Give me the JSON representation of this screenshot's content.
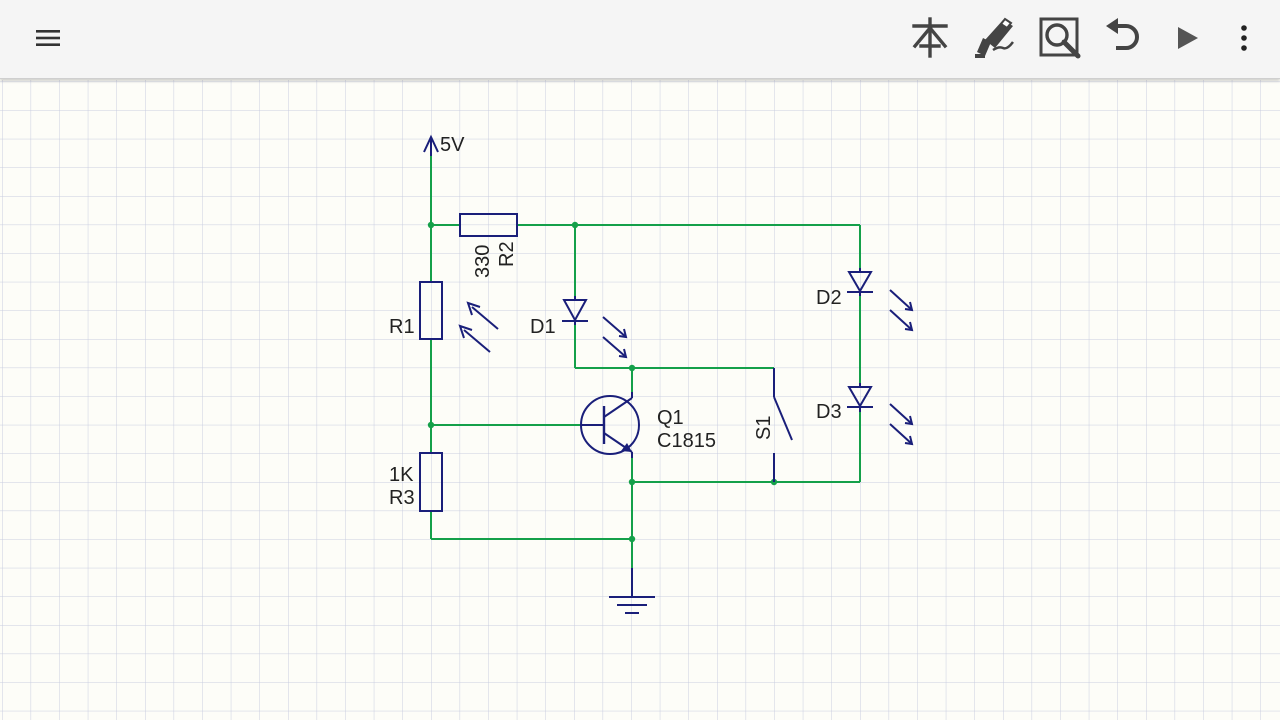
{
  "toolbar": {
    "icons": [
      "menu-icon",
      "component-icon",
      "edit-icon",
      "zoom-icon",
      "undo-icon",
      "play-icon",
      "more-vert-icon"
    ]
  },
  "colors": {
    "wire": "#14a04a",
    "component": "#1a1f7a",
    "grid": "#c9cde0",
    "background": "#fdfdf8",
    "toolbar": "#f5f5f5",
    "icon": "#444444"
  },
  "schematic": {
    "power_label": "5V",
    "r1": {
      "name": "R1"
    },
    "r2": {
      "name": "R2",
      "value": "330"
    },
    "r3": {
      "name": "R3",
      "value": "1K"
    },
    "d1": {
      "name": "D1"
    },
    "d2": {
      "name": "D2"
    },
    "d3": {
      "name": "D3"
    },
    "q1": {
      "name": "Q1",
      "value": "C1815"
    },
    "s1": {
      "name": "S1"
    }
  }
}
